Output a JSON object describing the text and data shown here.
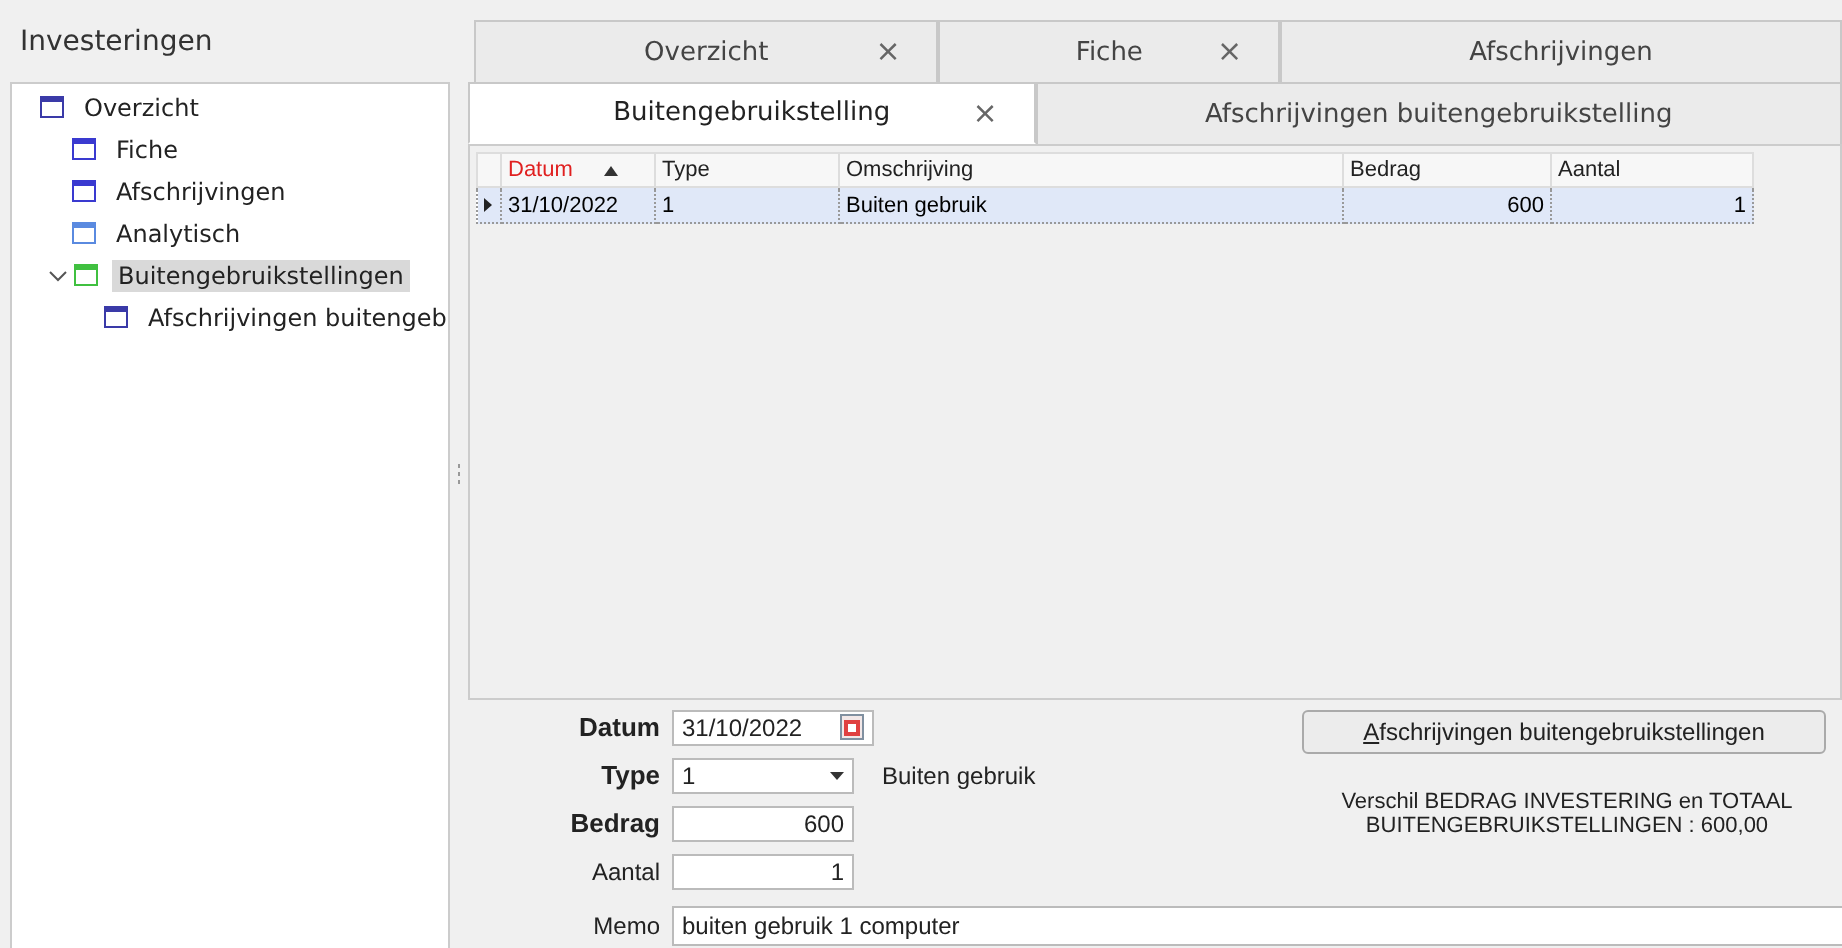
{
  "sidebar": {
    "title": "Investeringen",
    "tree": [
      {
        "label": "Overzicht",
        "color": "#3a3aa8",
        "selected": false,
        "children": [
          {
            "label": "Fiche",
            "color": "#3a3ad0",
            "selected": false
          },
          {
            "label": "Afschrijvingen",
            "color": "#3a3ad0",
            "selected": false
          },
          {
            "label": "Analytisch",
            "color": "#5a8ae0",
            "selected": false
          },
          {
            "label": "Buitengebruikstellingen",
            "color": "#40c040",
            "selected": true,
            "expanded": true,
            "children": [
              {
                "label": "Afschrijvingen buitengeb",
                "color": "#3a3aa8",
                "selected": false
              }
            ]
          }
        ]
      }
    ]
  },
  "tab_rows": [
    [
      {
        "label": "Overzicht",
        "closable": true,
        "selected": false
      },
      {
        "label": "Fiche",
        "closable": true,
        "selected": false
      },
      {
        "label": "Afschrijvingen",
        "closable": false,
        "selected": false
      }
    ],
    [
      {
        "label": "Buitengebruikstelling",
        "closable": true,
        "selected": true
      },
      {
        "label": "Afschrijvingen buitengebruikstelling",
        "closable": false,
        "selected": false
      }
    ]
  ],
  "close_glyph": "×",
  "table": {
    "columns": [
      {
        "label": "Datum",
        "sorted": true,
        "kind": "text"
      },
      {
        "label": "Type",
        "sorted": false,
        "kind": "text"
      },
      {
        "label": "Omschrijving",
        "sorted": false,
        "kind": "text"
      },
      {
        "label": "Bedrag",
        "sorted": false,
        "kind": "number"
      },
      {
        "label": "Aantal",
        "sorted": false,
        "kind": "number"
      }
    ],
    "rows": [
      {
        "cells": [
          "31/10/2022",
          "1",
          "Buiten gebruik",
          "600",
          "1"
        ],
        "selected": true
      }
    ]
  },
  "form": {
    "datum": {
      "label": "Datum",
      "value": "31/10/2022"
    },
    "type": {
      "label": "Type",
      "value": "1",
      "description": "Buiten gebruik"
    },
    "bedrag": {
      "label": "Bedrag",
      "value": "600"
    },
    "aantal": {
      "label": "Aantal",
      "value": "1"
    },
    "memo": {
      "label": "Memo",
      "value": "buiten gebruik 1 computer"
    },
    "button": {
      "accesskey": "A",
      "rest": "fschrijvingen buitengebruikstellingen"
    },
    "message": [
      "Verschil BEDRAG INVESTERING en TOTAAL",
      "BUITENGEBRUIKSTELLINGEN : 600,00"
    ]
  }
}
